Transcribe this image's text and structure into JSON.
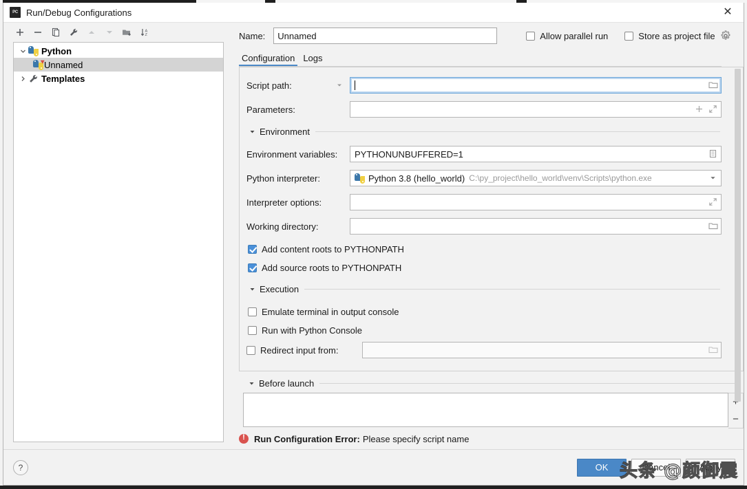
{
  "window": {
    "title": "Run/Debug Configurations",
    "logo_text": "PC",
    "close_icon": "close-icon"
  },
  "tree_toolbar": {
    "buttons": [
      {
        "name": "add-configuration-button",
        "icon": "plus-icon",
        "enabled": true
      },
      {
        "name": "remove-configuration-button",
        "icon": "minus-icon",
        "enabled": true
      },
      {
        "name": "copy-configuration-button",
        "icon": "copy-icon",
        "enabled": true
      },
      {
        "name": "edit-templates-button",
        "icon": "wrench-icon",
        "enabled": true
      },
      {
        "name": "move-up-button",
        "icon": "arrow-up-icon",
        "enabled": false
      },
      {
        "name": "move-down-button",
        "icon": "arrow-down-icon",
        "enabled": false
      },
      {
        "name": "create-folder-button",
        "icon": "folder-add-icon",
        "enabled": true
      },
      {
        "name": "sort-configurations-button",
        "icon": "sort-az-icon",
        "enabled": true
      }
    ]
  },
  "tree": {
    "nodes": [
      {
        "label": "Python",
        "icon": "python-icon",
        "expanded": true,
        "selected": false,
        "level": 0
      },
      {
        "label": "Unnamed",
        "icon": "python-run-icon",
        "expanded": null,
        "selected": true,
        "level": 1
      },
      {
        "label": "Templates",
        "icon": "wrench-icon",
        "expanded": false,
        "selected": false,
        "level": 0
      }
    ]
  },
  "header": {
    "name_label": "Name:",
    "name_value": "Unnamed",
    "name_placeholder": "",
    "allow_parallel_run": {
      "label": "Allow parallel run",
      "checked": false
    },
    "store_as_project_file": {
      "label": "Store as project file",
      "checked": false
    },
    "settings_icon": "gear-icon"
  },
  "tabs": [
    {
      "label": "Configuration",
      "active": true
    },
    {
      "label": "Logs",
      "active": false
    }
  ],
  "form": {
    "script_path": {
      "label": "Script path:",
      "value": "",
      "placeholder": "",
      "focused": true,
      "dropdown_icon": "chevron-down-icon",
      "browse_icon": "folder-icon"
    },
    "parameters": {
      "label": "Parameters:",
      "value": "",
      "placeholder": "",
      "insert_icon": "plus-icon",
      "expand_icon": "expand-icon"
    },
    "environment_section": {
      "title": "Environment",
      "expanded": true,
      "arrow_icon": "triangle-down-icon"
    },
    "environment_variables": {
      "label": "Environment variables:",
      "value": "PYTHONUNBUFFERED=1",
      "edit_icon": "list-edit-icon"
    },
    "python_interpreter": {
      "label": "Python interpreter:",
      "value": "Python 3.8 (hello_world)",
      "path": "C:\\py_project\\hello_world\\venv\\Scripts\\python.exe",
      "icon": "python-icon",
      "dropdown_icon": "chevron-down-icon"
    },
    "interpreter_options": {
      "label": "Interpreter options:",
      "value": "",
      "expand_icon": "expand-icon"
    },
    "working_directory": {
      "label": "Working directory:",
      "value": "",
      "browse_icon": "folder-icon"
    },
    "add_content_roots": {
      "label": "Add content roots to PYTHONPATH",
      "checked": true
    },
    "add_source_roots": {
      "label": "Add source roots to PYTHONPATH",
      "checked": true
    },
    "execution_section": {
      "title": "Execution",
      "expanded": true,
      "arrow_icon": "triangle-down-icon"
    },
    "emulate_terminal": {
      "label": "Emulate terminal in output console",
      "checked": false
    },
    "run_with_python_console": {
      "label": "Run with Python Console",
      "checked": false
    },
    "redirect_input_from": {
      "label": "Redirect input from:",
      "checked": false,
      "value": "",
      "browse_icon": "folder-icon"
    }
  },
  "before_launch": {
    "title": "Before launch",
    "expanded": true,
    "arrow_icon": "triangle-down-icon",
    "items": [],
    "add_button": "+",
    "remove_button": "−"
  },
  "error": {
    "icon": "error-icon",
    "prefix": "Run Configuration Error:",
    "message": "Please specify script name"
  },
  "footer": {
    "help_button": "?",
    "buttons": [
      {
        "label": "OK",
        "primary": true,
        "name": "ok-button"
      },
      {
        "label": "Cancel",
        "primary": false,
        "name": "cancel-button"
      },
      {
        "label": "Apply",
        "primary": false,
        "name": "apply-button"
      }
    ]
  },
  "watermark": {
    "text": "头条 @颜御震"
  },
  "colors": {
    "accent": "#4a88c7",
    "selection": "#d4d4d4",
    "error": "#d9534f",
    "checkbox_checked": "#4a90d9",
    "panel_bg": "#f2f2f2"
  }
}
